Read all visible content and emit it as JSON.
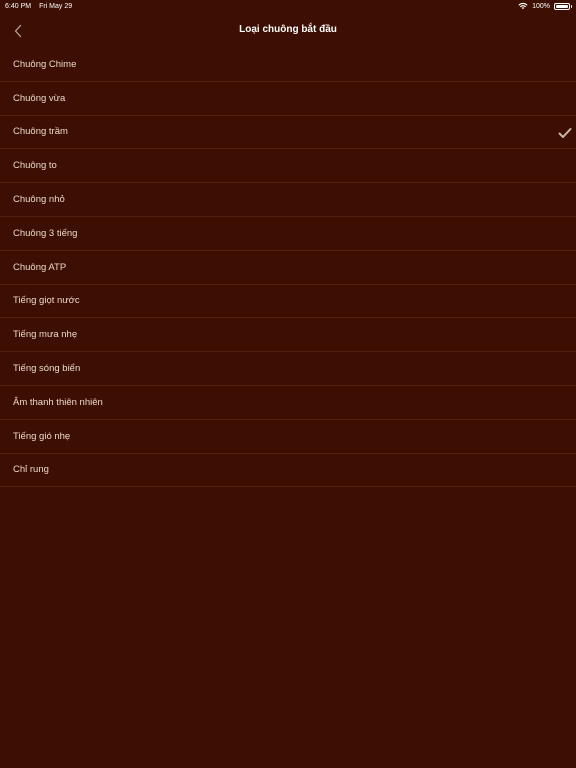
{
  "status_bar": {
    "time": "6:40 PM",
    "date": "Fri May 29",
    "battery": "100%",
    "battery_level": 1.0
  },
  "nav": {
    "title": "Loại chuông bắt đầu",
    "back_icon": "chevron-left-icon"
  },
  "list": {
    "items": [
      {
        "label": "Chuông Chime",
        "selected": false
      },
      {
        "label": "Chuông vừa",
        "selected": false
      },
      {
        "label": "Chuông trầm",
        "selected": true
      },
      {
        "label": "Chuông to",
        "selected": false
      },
      {
        "label": "Chuông nhỏ",
        "selected": false
      },
      {
        "label": "Chuông 3 tiếng",
        "selected": false
      },
      {
        "label": "Chuông ATP",
        "selected": false
      },
      {
        "label": "Tiếng giọt nước",
        "selected": false
      },
      {
        "label": "Tiếng mưa nhẹ",
        "selected": false
      },
      {
        "label": "Tiếng sóng biển",
        "selected": false
      },
      {
        "label": "Âm thanh thiên nhiên",
        "selected": false
      },
      {
        "label": "Tiếng gió nhẹ",
        "selected": false
      },
      {
        "label": "Chỉ rung",
        "selected": false
      }
    ],
    "selected_icon": "checkmark-icon"
  },
  "colors": {
    "background": "#3d0e02",
    "separator": "#54200f",
    "text": "#eadbcc",
    "accent": "#c9b8a8"
  }
}
